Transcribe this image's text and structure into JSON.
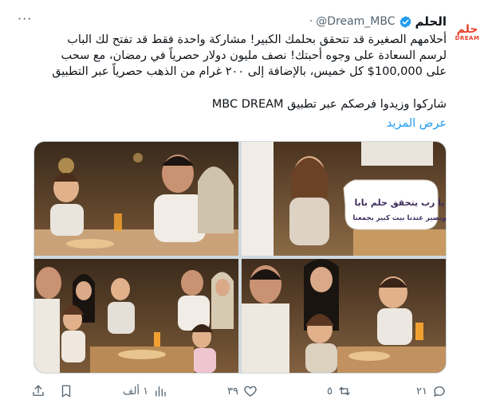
{
  "tweet": {
    "display_name": "الحلم",
    "handle": "@Dream_MBC",
    "time_dot": "·",
    "avatar_text": "حلم",
    "avatar_sub": "DREAM",
    "more_label": "···",
    "text": "أحلامهم الصغيرة قد تتحقق بحلمك الكبير! مشاركة واحدة فقط قد تفتح لك الباب\nلرسم السعادة على وجوه أحبتك! نصف مليون دولار حصرياً في رمضان، مع سحب\nعلى 100,000$ كل خميس، بالإضافة إلى ٢٠٠ غرام من الذهب حصرياً عبر التطبيق",
    "text_line2": "شاركوا وزيدوا فرصكم عبر تطبيق MBC DREAM",
    "show_more": "عرض المزيد",
    "bubble_line1": "يا رب يتحقق حلم بابا",
    "bubble_line2": "ويصير عندنا بيت كبير يجمعنا"
  },
  "actions": {
    "reply_count": "٢١",
    "retweet_count": "٥",
    "like_count": "٣٩",
    "views_count": "١ ألف"
  },
  "colors": {
    "accent": "#1d9bf0",
    "muted": "#536471",
    "brand": "#e8412c"
  }
}
